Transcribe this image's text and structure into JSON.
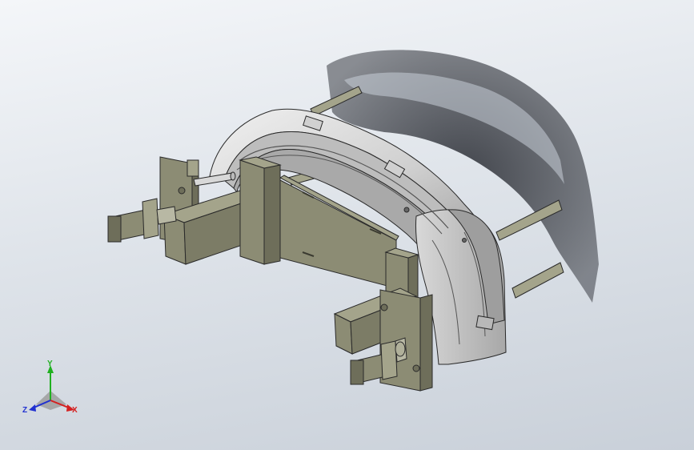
{
  "viewport": {
    "background_top": "#f4f6f9",
    "background_bottom": "#c9d0d9"
  },
  "colors": {
    "fixture": "#8c8c74",
    "fixture_light": "#a4a48b",
    "fixture_dark": "#6e6e5a",
    "bumper_light": "#e9e9e9",
    "bumper_mid": "#c2c2c2",
    "bumper_dark": "#8f8f8f",
    "shadow": "#3a3d44",
    "edge": "#2a2a2a",
    "axis_x": "#d42020",
    "axis_y": "#20b020",
    "axis_z": "#2030d0"
  },
  "triad": {
    "x_label": "X",
    "y_label": "Y",
    "z_label": "Z"
  }
}
